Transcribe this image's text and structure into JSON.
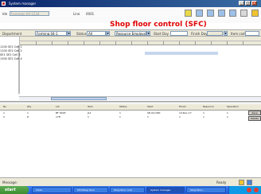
{
  "window": {
    "title": "System manager",
    "minimize": "_",
    "maximize": "□",
    "close": "x"
  },
  "header": {
    "user_label": "Ide",
    "user_value": "Foreman 04-1234",
    "date_label": "Line",
    "date_value": "0001",
    "main_title": "Shop floor control (SFC)"
  },
  "filters": {
    "department_label": "Department",
    "department_value": "Forming 04-1",
    "status_label": "Status",
    "status_value": "All",
    "resource_value": "Resource Employee",
    "start_label": "Start Day",
    "finish_label": "Finish Day",
    "item_code_label": "Item code"
  },
  "gantt": {
    "row_labels": [
      "1100 SE2 Cell 1",
      "1100 SE2 Cell 2",
      "SE1 SE2 Cell 3",
      "1300 SE2 Cell 4"
    ]
  },
  "table": {
    "columns": [
      "No",
      "Qty",
      "Lot",
      "Item",
      "Status",
      "Start",
      "Finish",
      "Resource",
      "Operation"
    ],
    "rows": [
      [
        "1",
        "1",
        "BF 0018",
        "JL1",
        "1",
        "SD-04-CN0",
        "14-Dec-17",
        "1",
        "1"
      ],
      [
        "2",
        "8",
        "178",
        "1",
        "1",
        "1",
        "1",
        "1",
        "1"
      ]
    ],
    "side_button_1": "Save",
    "side_button_2": "Delete"
  },
  "status": {
    "message_label": "Message:",
    "right_text": "Ready"
  },
  "taskbar": {
    "start_label": "start",
    "tasks": [
      "Inbox",
      "SFC/Shop floor",
      "Shop floor cont",
      "System manager",
      "Shop floor..."
    ]
  }
}
